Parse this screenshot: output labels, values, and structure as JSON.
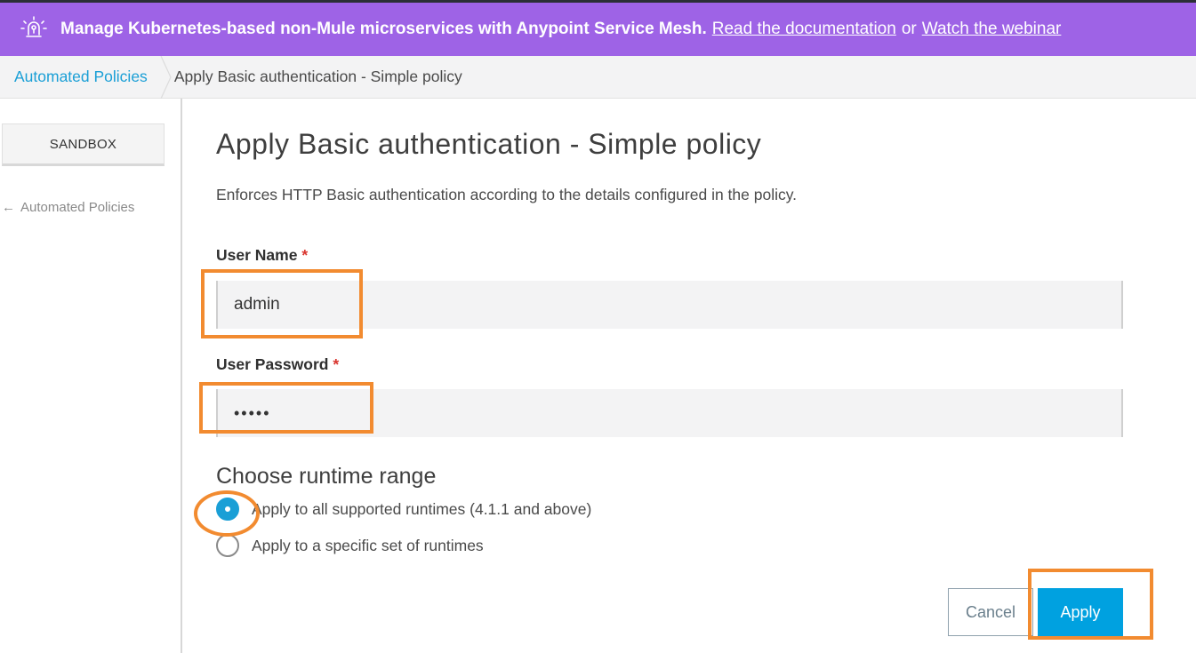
{
  "banner": {
    "message": "Manage Kubernetes-based non-Mule microservices with Anypoint Service Mesh.",
    "doc_link": "Read the documentation",
    "or_text": "or",
    "webinar_link": "Watch the webinar",
    "bg_color": "#9e63e6"
  },
  "breadcrumb": {
    "parent": "Automated Policies",
    "current": "Apply Basic authentication - Simple policy"
  },
  "sidebar": {
    "environment": "SANDBOX",
    "back_link": "Automated Policies",
    "back_arrow": "←"
  },
  "main": {
    "title": "Apply Basic authentication - Simple policy",
    "description": "Enforces HTTP Basic authentication according to the details configured in the policy.",
    "username": {
      "label": "User Name",
      "required": "*",
      "value": "admin"
    },
    "password": {
      "label": "User Password",
      "required": "*",
      "value": "•••••"
    },
    "runtime": {
      "title": "Choose runtime range",
      "options": [
        {
          "label": "Apply to all supported runtimes (4.1.1 and above)",
          "selected": true
        },
        {
          "label": "Apply to a specific set of runtimes",
          "selected": false
        }
      ]
    },
    "actions": {
      "cancel": "Cancel",
      "apply": "Apply"
    }
  },
  "colors": {
    "accent": "#1a9fd6",
    "apply_button": "#00a1e0",
    "highlight": "#f28b30",
    "required": "#d9352e"
  }
}
